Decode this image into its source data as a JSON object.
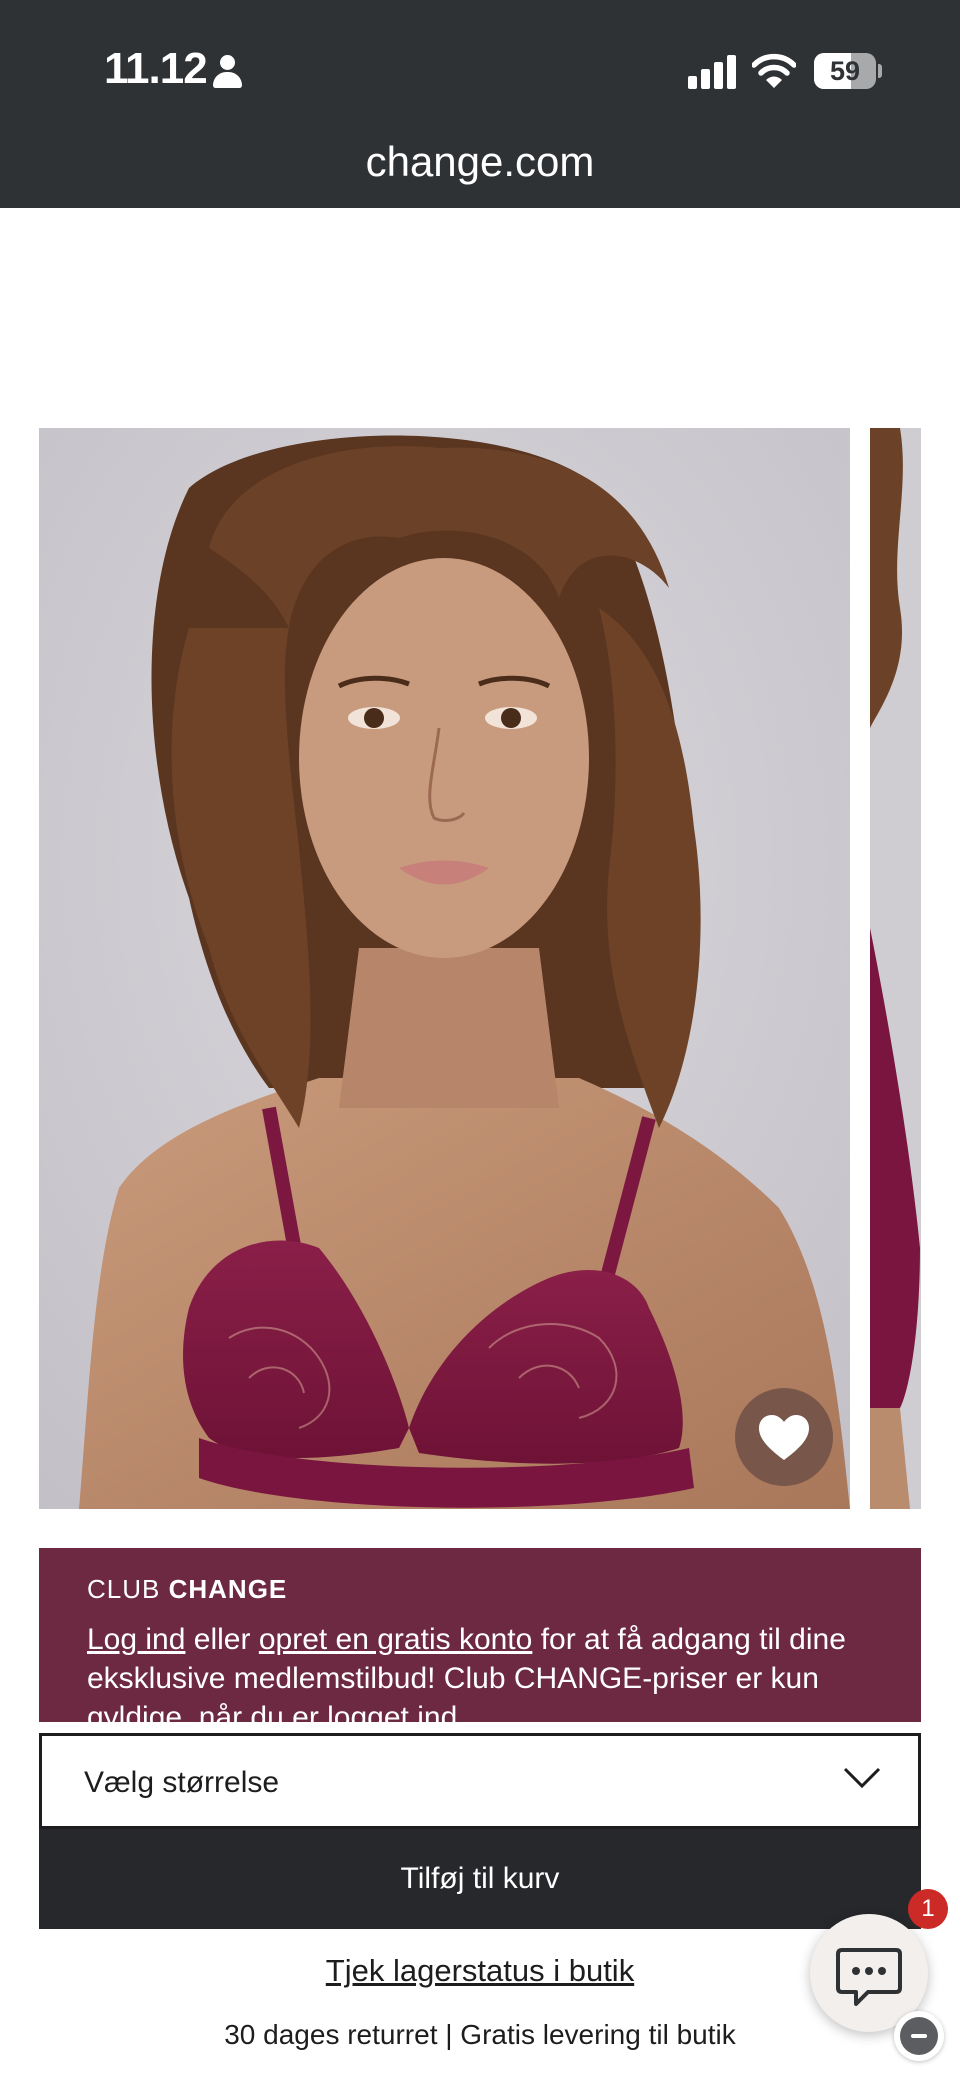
{
  "status_bar": {
    "time": "11.12",
    "battery": "59",
    "battery_fraction": 0.59,
    "icons": [
      "person-icon",
      "cellular-signal-icon",
      "wifi-icon",
      "battery-icon"
    ]
  },
  "browser": {
    "url": "change.com"
  },
  "product": {
    "images": [
      "product-photo-model-wine-lace-bra",
      "product-photo-next"
    ],
    "wishlist_icon": "heart-icon"
  },
  "club_banner": {
    "brand_light": "CLUB",
    "brand_bold": "CHANGE",
    "login_link": "Log ind",
    "text_1": "eller",
    "signup_link": "opret en gratis konto",
    "text_2": "for at få adgang til dine eksklusive medlemstilbud! Club CHANGE-priser er kun gyldige, når du er logget ind."
  },
  "purchase": {
    "size_select": "Vælg størrelse",
    "add_to_cart": "Tilføj til kurv",
    "stock_link": "Tjek lagerstatus i butik",
    "delivery_info": "30 dages returret | Gratis levering til butik"
  },
  "chat": {
    "badge_count": "1",
    "icon": "chat-bubble-icon",
    "minimize_icon": "minimize-icon"
  },
  "colors": {
    "topbar": "#2f3235",
    "club_banner": "#6d2941",
    "button_dark": "#26282b",
    "badge": "#cc2a26"
  }
}
